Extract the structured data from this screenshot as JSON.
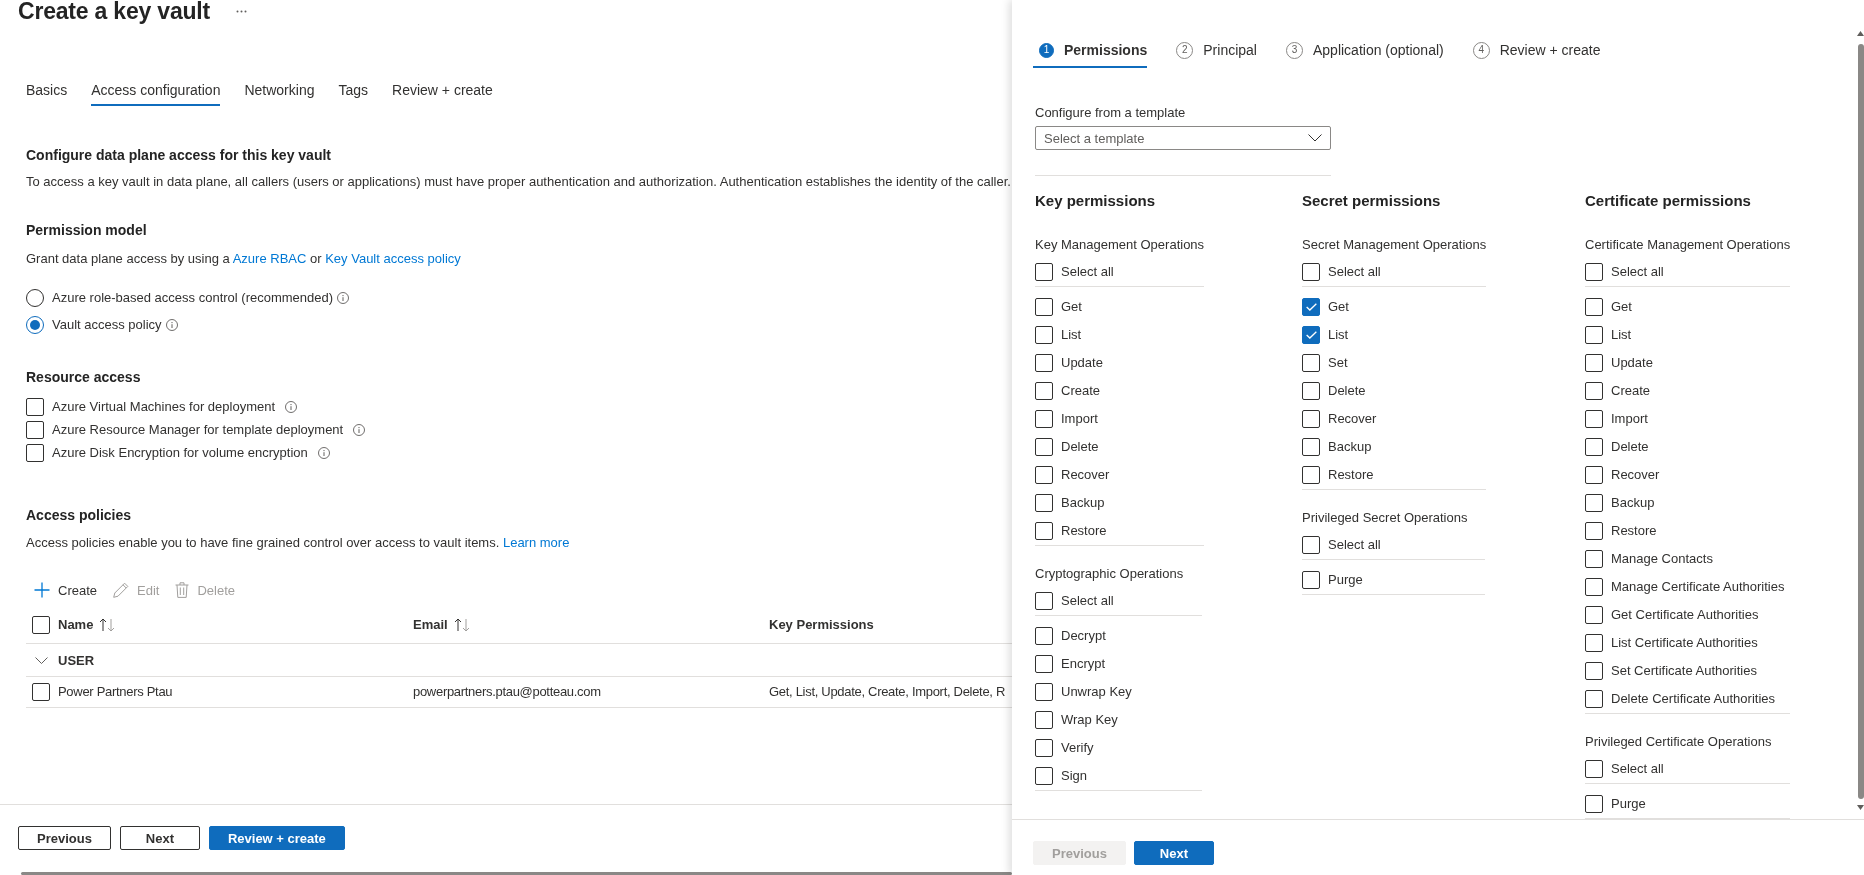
{
  "header": {
    "title": "Create a key vault"
  },
  "tabs": [
    {
      "label": "Basics",
      "selected": false
    },
    {
      "label": "Access configuration",
      "selected": true
    },
    {
      "label": "Networking",
      "selected": false
    },
    {
      "label": "Tags",
      "selected": false
    },
    {
      "label": "Review + create",
      "selected": false
    }
  ],
  "data_plane": {
    "heading": "Configure data plane access for this key vault",
    "text": "To access a key vault in data plane, all callers (users or applications) must have proper authentication and authorization. Authentication establishes the identity of the caller."
  },
  "permission_model": {
    "heading": "Permission model",
    "text": [
      {
        "kind": "text",
        "text": "Grant data plane access by using a "
      },
      {
        "kind": "link",
        "text": "Azure RBAC"
      },
      {
        "kind": "text",
        "text": " or "
      },
      {
        "kind": "link",
        "text": "Key Vault access policy"
      }
    ],
    "options": [
      {
        "label": "Azure role-based access control (recommended)",
        "selected": false
      },
      {
        "label": "Vault access policy",
        "selected": true
      }
    ]
  },
  "resource_access": {
    "heading": "Resource access",
    "options": [
      {
        "label": "Azure Virtual Machines for deployment",
        "checked": false
      },
      {
        "label": "Azure Resource Manager for template deployment",
        "checked": false
      },
      {
        "label": "Azure Disk Encryption for volume encryption",
        "checked": false
      }
    ]
  },
  "access_policies": {
    "heading": "Access policies",
    "text": [
      {
        "kind": "text",
        "text": "Access policies enable you to have fine grained control over access to vault items. "
      },
      {
        "kind": "link",
        "text": "Learn more"
      }
    ],
    "toolbar": [
      {
        "kind": "create",
        "label": "Create",
        "disabled": false
      },
      {
        "kind": "edit",
        "label": "Edit",
        "disabled": true
      },
      {
        "kind": "delete",
        "label": "Delete",
        "disabled": true
      }
    ],
    "table": {
      "all_checked": false,
      "columns": [
        {
          "label": "Name",
          "sortable": true
        },
        {
          "label": "Email",
          "sortable": true
        },
        {
          "label": "Key Permissions",
          "sortable": false
        }
      ],
      "groups": [
        {
          "label": "USER",
          "expanded": true,
          "rows": [
            {
              "checked": false,
              "cells": [
                "Power Partners Ptau",
                "powerpartners.ptau@potteau.com",
                "Get, List, Update, Create, Import, Delete, R"
              ]
            }
          ]
        }
      ]
    }
  },
  "footer": {
    "buttons": [
      {
        "label": "Previous",
        "kind": "secondary"
      },
      {
        "label": "Next",
        "kind": "secondary"
      },
      {
        "label": "Review + create",
        "kind": "primary"
      }
    ]
  },
  "panel": {
    "steps": [
      {
        "number": "1",
        "label": "Permissions",
        "selected": true
      },
      {
        "number": "2",
        "label": "Principal",
        "selected": false
      },
      {
        "number": "3",
        "label": "Application (optional)",
        "selected": false
      },
      {
        "number": "4",
        "label": "Review + create",
        "selected": false
      }
    ],
    "template": {
      "label": "Configure from a template",
      "placeholder": "Select a template"
    },
    "columns": [
      {
        "heading": "Key permissions",
        "groups": [
          {
            "title": "Key Management Operations",
            "select_all": {
              "label": "Select all",
              "checked": false
            },
            "items": [
              {
                "label": "Get",
                "checked": false
              },
              {
                "label": "List",
                "checked": false
              },
              {
                "label": "Update",
                "checked": false
              },
              {
                "label": "Create",
                "checked": false
              },
              {
                "label": "Import",
                "checked": false
              },
              {
                "label": "Delete",
                "checked": false
              },
              {
                "label": "Recover",
                "checked": false
              },
              {
                "label": "Backup",
                "checked": false
              },
              {
                "label": "Restore",
                "checked": false
              }
            ]
          },
          {
            "title": "Cryptographic Operations",
            "select_all": {
              "label": "Select all",
              "checked": false
            },
            "items": [
              {
                "label": "Decrypt",
                "checked": false
              },
              {
                "label": "Encrypt",
                "checked": false
              },
              {
                "label": "Unwrap Key",
                "checked": false
              },
              {
                "label": "Wrap Key",
                "checked": false
              },
              {
                "label": "Verify",
                "checked": false
              },
              {
                "label": "Sign",
                "checked": false
              }
            ]
          }
        ]
      },
      {
        "heading": "Secret permissions",
        "groups": [
          {
            "title": "Secret Management Operations",
            "select_all": {
              "label": "Select all",
              "checked": false
            },
            "items": [
              {
                "label": "Get",
                "checked": true
              },
              {
                "label": "List",
                "checked": true
              },
              {
                "label": "Set",
                "checked": false
              },
              {
                "label": "Delete",
                "checked": false
              },
              {
                "label": "Recover",
                "checked": false
              },
              {
                "label": "Backup",
                "checked": false
              },
              {
                "label": "Restore",
                "checked": false
              }
            ]
          },
          {
            "title": "Privileged Secret Operations",
            "select_all": {
              "label": "Select all",
              "checked": false
            },
            "items": [
              {
                "label": "Purge",
                "checked": false
              }
            ]
          }
        ]
      },
      {
        "heading": "Certificate permissions",
        "groups": [
          {
            "title": "Certificate Management Operations",
            "select_all": {
              "label": "Select all",
              "checked": false
            },
            "items": [
              {
                "label": "Get",
                "checked": false
              },
              {
                "label": "List",
                "checked": false
              },
              {
                "label": "Update",
                "checked": false
              },
              {
                "label": "Create",
                "checked": false
              },
              {
                "label": "Import",
                "checked": false
              },
              {
                "label": "Delete",
                "checked": false
              },
              {
                "label": "Recover",
                "checked": false
              },
              {
                "label": "Backup",
                "checked": false
              },
              {
                "label": "Restore",
                "checked": false
              },
              {
                "label": "Manage Contacts",
                "checked": false
              },
              {
                "label": "Manage Certificate Authorities",
                "checked": false
              },
              {
                "label": "Get Certificate Authorities",
                "checked": false
              },
              {
                "label": "List Certificate Authorities",
                "checked": false
              },
              {
                "label": "Set Certificate Authorities",
                "checked": false
              },
              {
                "label": "Delete Certificate Authorities",
                "checked": false
              }
            ]
          },
          {
            "title": "Privileged Certificate Operations",
            "select_all": {
              "label": "Select all",
              "checked": false
            },
            "items": [
              {
                "label": "Purge",
                "checked": false
              }
            ]
          }
        ]
      }
    ],
    "buttons": [
      {
        "label": "Previous",
        "kind": "secondary",
        "disabled": true
      },
      {
        "label": "Next",
        "kind": "primary",
        "disabled": false
      }
    ]
  }
}
